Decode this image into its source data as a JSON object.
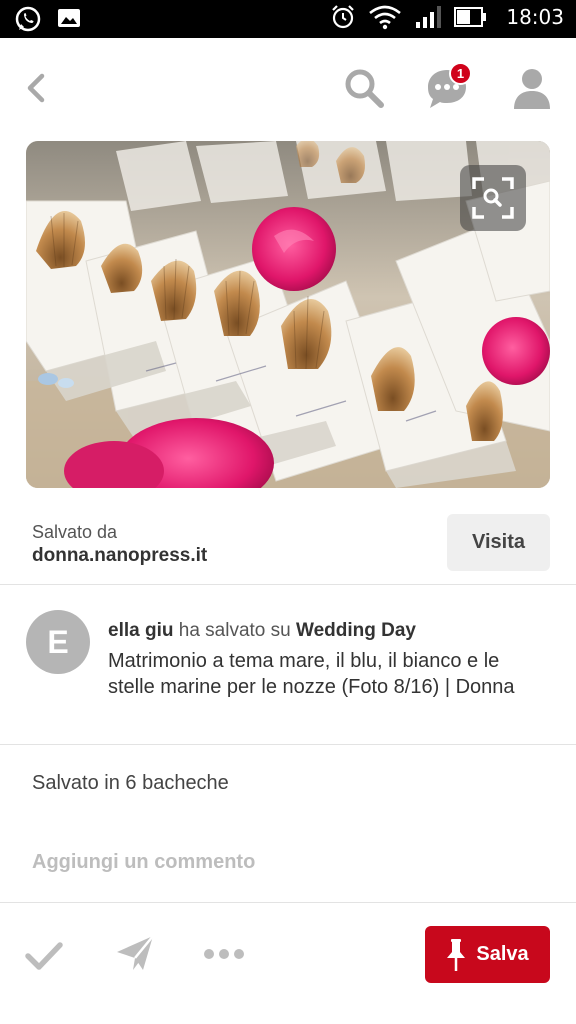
{
  "status_bar": {
    "time": "18:03",
    "left_icons": [
      "whatsapp-icon",
      "gallery-icon"
    ],
    "right_icons": [
      "alarm-icon",
      "wifi-icon",
      "signal-icon",
      "battery-icon"
    ]
  },
  "nav": {
    "icons": [
      "back-arrow-icon",
      "search-icon",
      "messages-icon",
      "profile-icon"
    ],
    "notification_count": "1"
  },
  "pin": {
    "image_alt": "Seashell place cards with names, pink roses on sand",
    "lens_icon": "visual-search-icon"
  },
  "source": {
    "saved_from_label": "Salvato da",
    "domain": "donna.nanopress.it",
    "visit_label": "Visita"
  },
  "pinner": {
    "avatar_letter": "E",
    "name": "ella giu",
    "action": "ha salvato su",
    "board": "Wedding Day",
    "description": "Matrimonio a tema mare, il blu, il bianco e le stelle marine per le nozze (Foto 8/16) | Donna"
  },
  "stats": {
    "saved_count": "Salvato in 6 bacheche"
  },
  "comment": {
    "placeholder": "Aggiungi un commento"
  },
  "actions": {
    "icons": [
      "check-icon",
      "send-icon",
      "more-icon",
      "pin-icon"
    ],
    "save_label": "Salva"
  },
  "colors": {
    "accent": "#c8081c",
    "badge": "#d0021b",
    "icon_gray": "#bdbdbd"
  }
}
